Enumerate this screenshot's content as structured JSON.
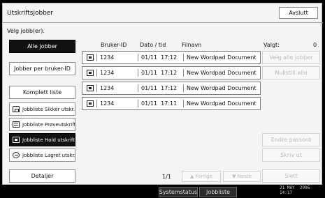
{
  "header": {
    "title": "Utskriftsjobber",
    "close_label": "Avslutt"
  },
  "instruction": "Velg jobb(er).",
  "columns": {
    "user_id": "Bruker-ID",
    "datetime": "Dato / tid",
    "filename": "Filnavn"
  },
  "selected": {
    "label": "Valgt:",
    "count": "0"
  },
  "left_buttons": {
    "all_jobs": "Alle jobber",
    "jobs_per_user": "Jobber per bruker-ID",
    "complete_list": "Komplett liste",
    "secure_list": "Jobbliste Sikker utskr.",
    "sample_list": "Jobbliste Prøveutskrift",
    "hold_list": "Jobbliste Hold utskrift",
    "stored_list": "Jobbliste Lagret utskr.",
    "details": "Detaljer"
  },
  "jobs": [
    {
      "icon": "print-job-icon",
      "user_id": "1234",
      "datetime": "01/11  17:12",
      "filename": "New Wordpad Document"
    },
    {
      "icon": "print-job-icon",
      "user_id": "1234",
      "datetime": "01/11  17:12",
      "filename": "New Wordpad Document"
    },
    {
      "icon": "print-job-icon",
      "user_id": "1234",
      "datetime": "01/11  17:12",
      "filename": "New Wordpad Document"
    },
    {
      "icon": "print-job-icon",
      "user_id": "1234",
      "datetime": "01/11  17:11",
      "filename": "New Wordpad Document"
    }
  ],
  "right_buttons": {
    "select_all": "Velg alle jobber",
    "reset_all": "Nullstill alle",
    "change_password": "Endre passord",
    "print": "Skriv ut",
    "delete": "Slett"
  },
  "pagination": {
    "page": "1/1",
    "prev": "▲ Forrige",
    "next": "▼ Neste"
  },
  "statusbar": {
    "system_status": "Systemstatus",
    "job_list": "Jobbliste",
    "date": "21 MAY  2006",
    "time": "14:17"
  }
}
